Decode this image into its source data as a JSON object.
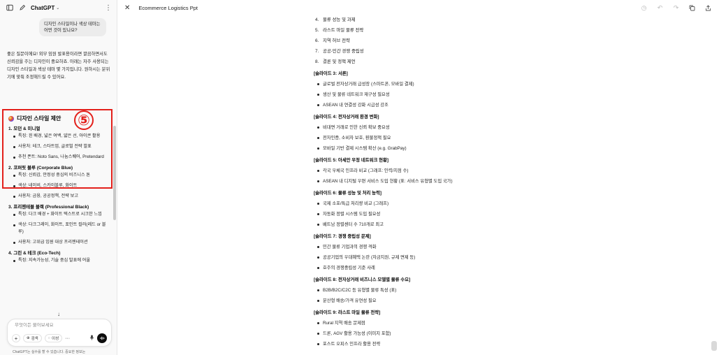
{
  "chat": {
    "app_title": "ChatGPT",
    "user_message": "디자인 스타일이나 색상 테마는 어떤 것이 있나요?",
    "assistant_intro": "좋은 질문이에요! 외부 임원 발표용이라면 깔끔하면서도 신뢰감을 주는 디자인이 중요하죠. 아래는 자주 사용되는 디자인 스타일과 색상 테마 몇 가지입니다. 원하시는 분위기에 맞춰 조정해드릴 수 있어요.",
    "section_title": "디자인 스타일 제안",
    "annotation_number": "⑤",
    "styles": [
      {
        "title": "1. 모던 & 미니멀",
        "points": [
          "특징: 흰 배경, 넓은 여백, 얇은 선, 아이콘 활용",
          "사용처: 테크, 스타트업, 글로벌 전략 발표",
          "추천 폰트: Noto Sans, 나눔스퀘어, Pretendard"
        ]
      },
      {
        "title": "2. 코퍼릿 블루 (Corporate Blue)",
        "points": [
          "특징: 신뢰감, 안정성 중심의 비즈니스 톤",
          "색상: 네이비, 스카이블루, 화이트",
          "사용처: 금융, 공공정책, 전략 보고"
        ]
      },
      {
        "title": "3. 프리젠테블 블랙 (Professional Black)",
        "points": [
          "특징: 다크 배경 + 화이트 텍스트로 시크한 느낌",
          "색상: 다크그레이, 화이트, 포인트 컬러(레드 or 블루)",
          "사용처: 고위급 임원 대상 프리젠테이션"
        ]
      },
      {
        "title": "4. 그린 & 테크 (Eco-Tech)",
        "points": [
          "특징: 지속가능성, 기술 중심 발표에 어울"
        ]
      }
    ],
    "composer": {
      "placeholder": "무엇이든 물어보세요",
      "plus": "+",
      "search_chip": "검색",
      "reason_chip": "이성",
      "more": "···"
    },
    "disclaimer": "ChatGPT는 실수를 할 수 있습니다. 중요한 정보는"
  },
  "document": {
    "title": "Ecommerce Logistics Ppt",
    "numbered_items": [
      {
        "n": "4.",
        "text": "물류 성능 및 과제"
      },
      {
        "n": "5.",
        "text": "라스트 마일 물류 전략"
      },
      {
        "n": "6.",
        "text": "지역 허브 전략"
      },
      {
        "n": "7.",
        "text": "공공-민간 경쟁 중립성"
      },
      {
        "n": "8.",
        "text": "결론 및 정책 제언"
      }
    ],
    "slides": [
      {
        "heading": "[슬라이드 3: 서론]",
        "bullets": [
          "글로벌 전자상거래 급성장 (스마트폰, 모바일 결제)",
          "생산 및 물류 네트워크 재구성 필요성",
          "ASEAN 내 연결성 강화 시급성 강조"
        ]
      },
      {
        "heading": "[슬라이드 4: 전자상거래 환경 변화]",
        "bullets": [
          "비대면 거래로 인한 신뢰 확보 중요성",
          "전자인증, 소비자 보호, 환불정책 필요",
          "모바일 기반 결제 시스템 확산 (e.g. GrabPay)"
        ]
      },
      {
        "heading": "[슬라이드 5: 아세안 우정 네트워크 현황]",
        "bullets": [
          "각국 우체국 인프라 비교 (그래프: 인력/지점 수)",
          "ASEAN 내 디지털 우편 서비스 도입 현황 (표: 서비스 유형별 도입 국가)"
        ]
      },
      {
        "heading": "[슬라이드 6: 물류 성능 및 처리 능력]",
        "bullets": [
          "국제 소포/특급 처리량 비교 (그래프)",
          "자동화 정렬 시스템 도입 필요성",
          "베트남 정렬센터 수 710개로 최고"
        ]
      },
      {
        "heading": "[슬라이드 7: 경쟁 중립성 문제]",
        "bullets": [
          "민간 물류 기업과의 경쟁 격화",
          "공공기업의 우대혜택 논란 (자금지원, 규제 면제 등)",
          "호주의 경쟁중립성 기준 사례"
        ]
      },
      {
        "heading": "[슬라이드 8: 전자상거래 비즈니스 모델별 물류 수요]",
        "bullets": [
          "B2B/B2C/C2C 등 유형별 물류 특성 (표)",
          "분산형 배송/가격 유연성 필요"
        ]
      },
      {
        "heading": "[슬라이드 9: 라스트 마일 물류 전략]",
        "bullets": [
          "Rural 지역 배송 문제점",
          "드론, AGV 활용 가능성 (이미지 포함)",
          "포스트 오피스 인프라 활용 전략"
        ]
      }
    ]
  },
  "colors": {
    "annotation_red": "#e3201b",
    "panel_bg": "#f9f9f9"
  }
}
